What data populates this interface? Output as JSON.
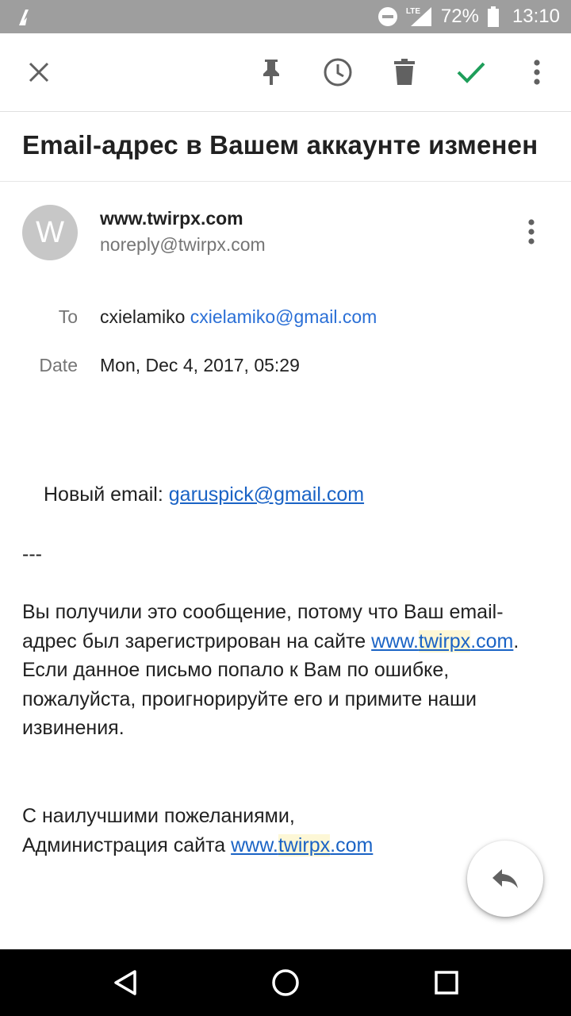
{
  "status_bar": {
    "network": "LTE",
    "battery": "72%",
    "time": "13:10"
  },
  "toolbar": {
    "icons": [
      "close-icon",
      "pin-icon",
      "snooze-clock-icon",
      "delete-icon",
      "done-check-icon",
      "more-vert-icon"
    ],
    "accent_check": "#1e9e5a"
  },
  "email": {
    "subject": "Email-адрес в Вашем аккаунте изменен",
    "sender": {
      "avatar_letter": "W",
      "name": "www.twirpx.com",
      "address": "noreply@twirpx.com"
    },
    "details": {
      "to_label": "To",
      "to_name": "cxielamiko",
      "to_address": "cxielamiko@gmail.com",
      "date_label": "Date",
      "date_value": "Mon, Dec 4, 2017, 05:29"
    },
    "body": {
      "new_email_label": "Новый email: ",
      "new_email_link": "garuspick@gmail.com",
      "separator": "---",
      "para1_a": "Вы получили это сообщение, потому что Ваш email-адрес был зарегистрирован на сайте ",
      "para1_link_a": "www.",
      "para1_link_b": "twirpx",
      "para1_link_c": ".com",
      "para1_end": ".",
      "para2": "Если данное письмо попало к Вам по ошибке, пожалуйста, проигнорируйте его и примите наши извинения.",
      "closing1": "С наилучшими пожеланиями,",
      "closing2": "Администрация сайта ",
      "closing_link_a": "www.",
      "closing_link_b": "twirpx",
      "closing_link_c": ".com"
    }
  },
  "fab": {
    "icon": "reply-icon"
  },
  "nav_bar": {
    "icons": [
      "back-icon",
      "home-icon",
      "recents-icon"
    ]
  }
}
